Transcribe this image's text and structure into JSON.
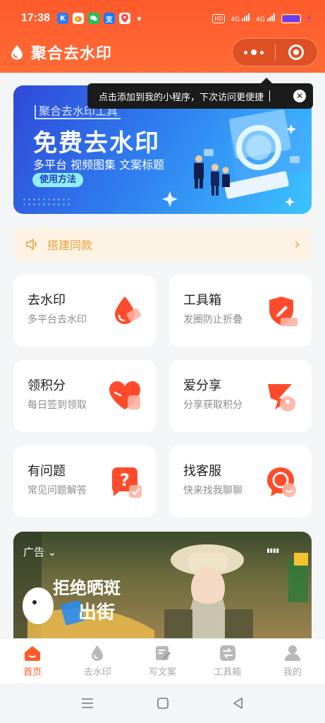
{
  "status_bar": {
    "time": "17:38",
    "app_icons": [
      {
        "name": "k-app-icon",
        "letter": "K",
        "color": "#2a7cf6"
      },
      {
        "name": "weibo-icon",
        "letter": "",
        "color": "#ff8a00"
      },
      {
        "name": "wechat-icon",
        "letter": "",
        "color": "#21c15f"
      },
      {
        "name": "alipay-icon",
        "letter": "支",
        "color": "#1677ff"
      },
      {
        "name": "map-pin-icon",
        "letter": "",
        "color": "#ff3b3b"
      }
    ],
    "hd_label": "HD",
    "signal_1": "4G",
    "signal_2": "4G"
  },
  "app_bar": {
    "title": "聚合去水印"
  },
  "tooltip": {
    "text": "点击添加到我的小程序，下次访问更便捷",
    "close": "✕"
  },
  "banner": {
    "subtag": "聚合去水印工具",
    "headline": "免费去水印",
    "description": "多平台 视频图集 文案标题",
    "button": "使用方法"
  },
  "notice": {
    "text": "搭建同款",
    "chevron": "›"
  },
  "cards": [
    {
      "title": "去水印",
      "subtitle": "多平台去水印",
      "icon": "watermark-drop-icon"
    },
    {
      "title": "工具箱",
      "subtitle": "发圈防止折叠",
      "icon": "toolbox-shield-icon"
    },
    {
      "title": "领积分",
      "subtitle": "每日签到领取",
      "icon": "heart-points-icon"
    },
    {
      "title": "爱分享",
      "subtitle": "分享获取积分",
      "icon": "share-icon"
    },
    {
      "title": "有问题",
      "subtitle": "常见问题解答",
      "icon": "question-icon"
    },
    {
      "title": "找客服",
      "subtitle": "快来找我聊聊",
      "icon": "customer-service-icon"
    }
  ],
  "ad": {
    "tag": "广告",
    "slogan_1": "拒绝晒斑",
    "slogan_2": "出街"
  },
  "tab_bar": {
    "tabs": [
      {
        "label": "首页",
        "icon": "home-icon",
        "active": true
      },
      {
        "label": "去水印",
        "icon": "drop-icon",
        "active": false
      },
      {
        "label": "写文案",
        "icon": "edit-icon",
        "active": false
      },
      {
        "label": "工具箱",
        "icon": "toolbox-icon",
        "active": false
      },
      {
        "label": "我的",
        "icon": "profile-icon",
        "active": false
      }
    ]
  },
  "colors": {
    "primary": "#ff5b2c",
    "notice_text": "#e8a33a",
    "notice_bg": "#fdf3e4",
    "card_icon": "#ff4b2b"
  }
}
